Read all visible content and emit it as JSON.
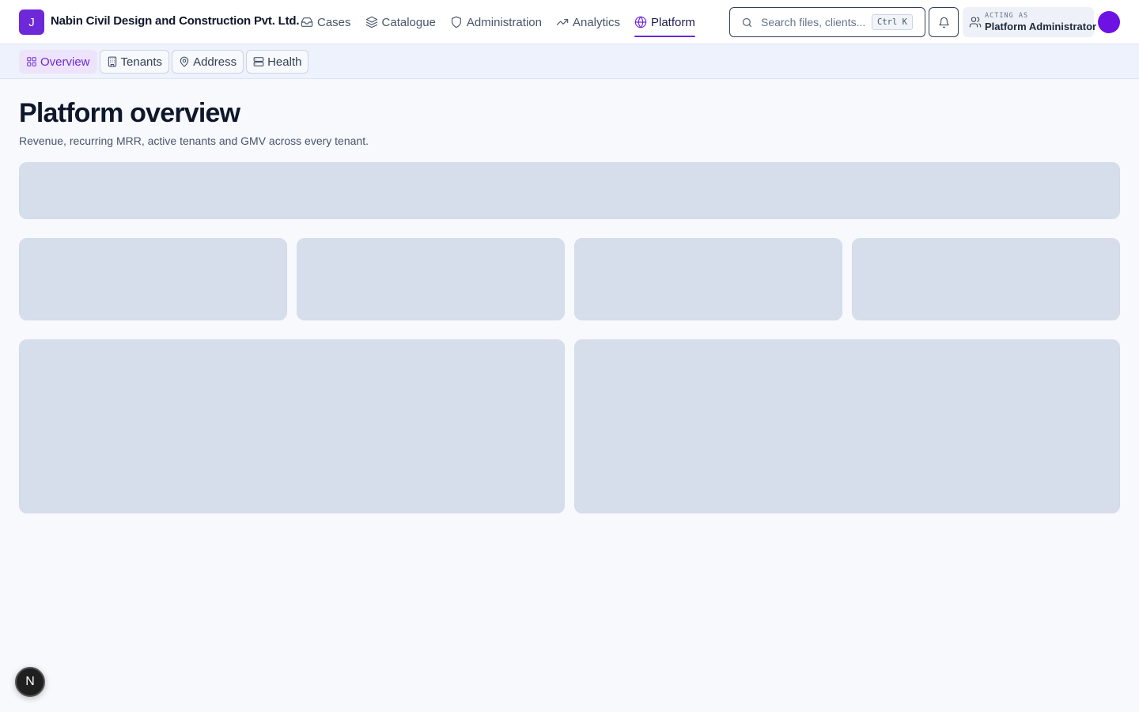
{
  "header": {
    "logo_letter": "J",
    "org_name": "Nabin Civil Design and Construction Pvt. Ltd.",
    "nav": [
      {
        "label": "Cases",
        "icon": "inbox-icon"
      },
      {
        "label": "Catalogue",
        "icon": "layers-icon"
      },
      {
        "label": "Administration",
        "icon": "shield-icon"
      },
      {
        "label": "Analytics",
        "icon": "trending-up-icon"
      },
      {
        "label": "Platform",
        "icon": "globe-icon",
        "active": true
      }
    ],
    "search": {
      "placeholder": "Search files, clients...",
      "shortcut": "Ctrl K"
    },
    "acting": {
      "label": "ACTING AS",
      "role": "Platform Administrator"
    }
  },
  "subnav": {
    "tabs": [
      {
        "label": "Overview",
        "icon": "grid-icon",
        "active": true
      },
      {
        "label": "Tenants",
        "icon": "building-icon"
      },
      {
        "label": "Address",
        "icon": "map-pin-icon"
      },
      {
        "label": "Health",
        "icon": "server-icon"
      }
    ]
  },
  "page": {
    "title": "Platform overview",
    "subtitle": "Revenue, recurring MRR, active tenants and GMV across every tenant."
  },
  "fab": {
    "letter": "N"
  },
  "colors": {
    "accent": "#6d28d9",
    "skeleton": "#d7deeb",
    "background": "#f7f9fd"
  }
}
